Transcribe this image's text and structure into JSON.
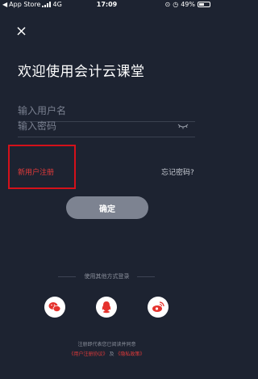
{
  "status_bar": {
    "carrier": "App Store",
    "network": "4G",
    "time": "17:09",
    "battery": "49%"
  },
  "page": {
    "title": "欢迎使用会计云课堂"
  },
  "form": {
    "username_placeholder": "输入用户名",
    "password_placeholder": "输入密码",
    "register_label": "新用户注册",
    "forgot_label": "忘记密码?",
    "confirm_label": "确定"
  },
  "other_login": {
    "label": "使用其他方式登录",
    "options": [
      {
        "name": "wechat",
        "icon": "wechat-icon",
        "color": "#e5322d"
      },
      {
        "name": "qq",
        "icon": "qq-icon",
        "color": "#e5322d"
      },
      {
        "name": "weibo",
        "icon": "weibo-icon",
        "color": "#e5322d"
      }
    ]
  },
  "agreement": {
    "text": "注册即代表您已阅读并同意",
    "user_agreement": "《用户注册协议》",
    "and": "及",
    "privacy_policy": "《隐私政策》"
  },
  "colors": {
    "background": "#1d2331",
    "accent": "#e23a3a",
    "button": "#7d8391"
  }
}
